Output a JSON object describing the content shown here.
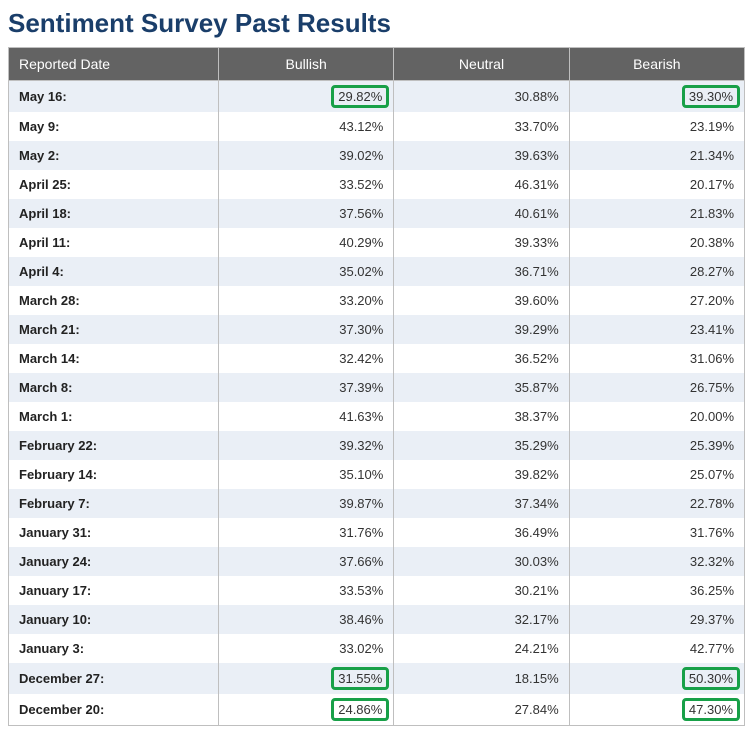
{
  "title": "Sentiment Survey Past Results",
  "columns": {
    "date": "Reported Date",
    "bullish": "Bullish",
    "neutral": "Neutral",
    "bearish": "Bearish"
  },
  "rows": [
    {
      "date": "May 16:",
      "bullish": "29.82%",
      "neutral": "30.88%",
      "bearish": "39.30%",
      "hl_bullish": true,
      "hl_bearish": true
    },
    {
      "date": "May 9:",
      "bullish": "43.12%",
      "neutral": "33.70%",
      "bearish": "23.19%"
    },
    {
      "date": "May 2:",
      "bullish": "39.02%",
      "neutral": "39.63%",
      "bearish": "21.34%"
    },
    {
      "date": "April 25:",
      "bullish": "33.52%",
      "neutral": "46.31%",
      "bearish": "20.17%"
    },
    {
      "date": "April 18:",
      "bullish": "37.56%",
      "neutral": "40.61%",
      "bearish": "21.83%"
    },
    {
      "date": "April 11:",
      "bullish": "40.29%",
      "neutral": "39.33%",
      "bearish": "20.38%"
    },
    {
      "date": "April 4:",
      "bullish": "35.02%",
      "neutral": "36.71%",
      "bearish": "28.27%"
    },
    {
      "date": "March 28:",
      "bullish": "33.20%",
      "neutral": "39.60%",
      "bearish": "27.20%"
    },
    {
      "date": "March 21:",
      "bullish": "37.30%",
      "neutral": "39.29%",
      "bearish": "23.41%"
    },
    {
      "date": "March 14:",
      "bullish": "32.42%",
      "neutral": "36.52%",
      "bearish": "31.06%"
    },
    {
      "date": "March 8:",
      "bullish": "37.39%",
      "neutral": "35.87%",
      "bearish": "26.75%"
    },
    {
      "date": "March 1:",
      "bullish": "41.63%",
      "neutral": "38.37%",
      "bearish": "20.00%"
    },
    {
      "date": "February 22:",
      "bullish": "39.32%",
      "neutral": "35.29%",
      "bearish": "25.39%"
    },
    {
      "date": "February 14:",
      "bullish": "35.10%",
      "neutral": "39.82%",
      "bearish": "25.07%"
    },
    {
      "date": "February 7:",
      "bullish": "39.87%",
      "neutral": "37.34%",
      "bearish": "22.78%"
    },
    {
      "date": "January 31:",
      "bullish": "31.76%",
      "neutral": "36.49%",
      "bearish": "31.76%"
    },
    {
      "date": "January 24:",
      "bullish": "37.66%",
      "neutral": "30.03%",
      "bearish": "32.32%"
    },
    {
      "date": "January 17:",
      "bullish": "33.53%",
      "neutral": "30.21%",
      "bearish": "36.25%"
    },
    {
      "date": "January 10:",
      "bullish": "38.46%",
      "neutral": "32.17%",
      "bearish": "29.37%"
    },
    {
      "date": "January 3:",
      "bullish": "33.02%",
      "neutral": "24.21%",
      "bearish": "42.77%"
    },
    {
      "date": "December 27:",
      "bullish": "31.55%",
      "neutral": "18.15%",
      "bearish": "50.30%",
      "hl_bullish": true,
      "hl_bearish": true
    },
    {
      "date": "December 20:",
      "bullish": "24.86%",
      "neutral": "27.84%",
      "bearish": "47.30%",
      "hl_bullish": true,
      "hl_bearish": true
    }
  ],
  "chart_data": {
    "type": "table",
    "title": "Sentiment Survey Past Results",
    "columns": [
      "Reported Date",
      "Bullish",
      "Neutral",
      "Bearish"
    ],
    "series": [
      {
        "name": "Bullish",
        "values": [
          29.82,
          43.12,
          39.02,
          33.52,
          37.56,
          40.29,
          35.02,
          33.2,
          37.3,
          32.42,
          37.39,
          41.63,
          39.32,
          35.1,
          39.87,
          31.76,
          37.66,
          33.53,
          38.46,
          33.02,
          31.55,
          24.86
        ]
      },
      {
        "name": "Neutral",
        "values": [
          30.88,
          33.7,
          39.63,
          46.31,
          40.61,
          39.33,
          36.71,
          39.6,
          39.29,
          36.52,
          35.87,
          38.37,
          35.29,
          39.82,
          37.34,
          36.49,
          30.03,
          30.21,
          32.17,
          24.21,
          18.15,
          27.84
        ]
      },
      {
        "name": "Bearish",
        "values": [
          39.3,
          23.19,
          21.34,
          20.17,
          21.83,
          20.38,
          28.27,
          27.2,
          23.41,
          31.06,
          26.75,
          20.0,
          25.39,
          25.07,
          22.78,
          31.76,
          32.32,
          36.25,
          29.37,
          42.77,
          50.3,
          47.3
        ]
      }
    ],
    "categories": [
      "May 16",
      "May 9",
      "May 2",
      "April 25",
      "April 18",
      "April 11",
      "April 4",
      "March 28",
      "March 21",
      "March 14",
      "March 8",
      "March 1",
      "February 22",
      "February 14",
      "February 7",
      "January 31",
      "January 24",
      "January 17",
      "January 10",
      "January 3",
      "December 27",
      "December 20"
    ],
    "ylim": [
      0,
      100
    ]
  }
}
